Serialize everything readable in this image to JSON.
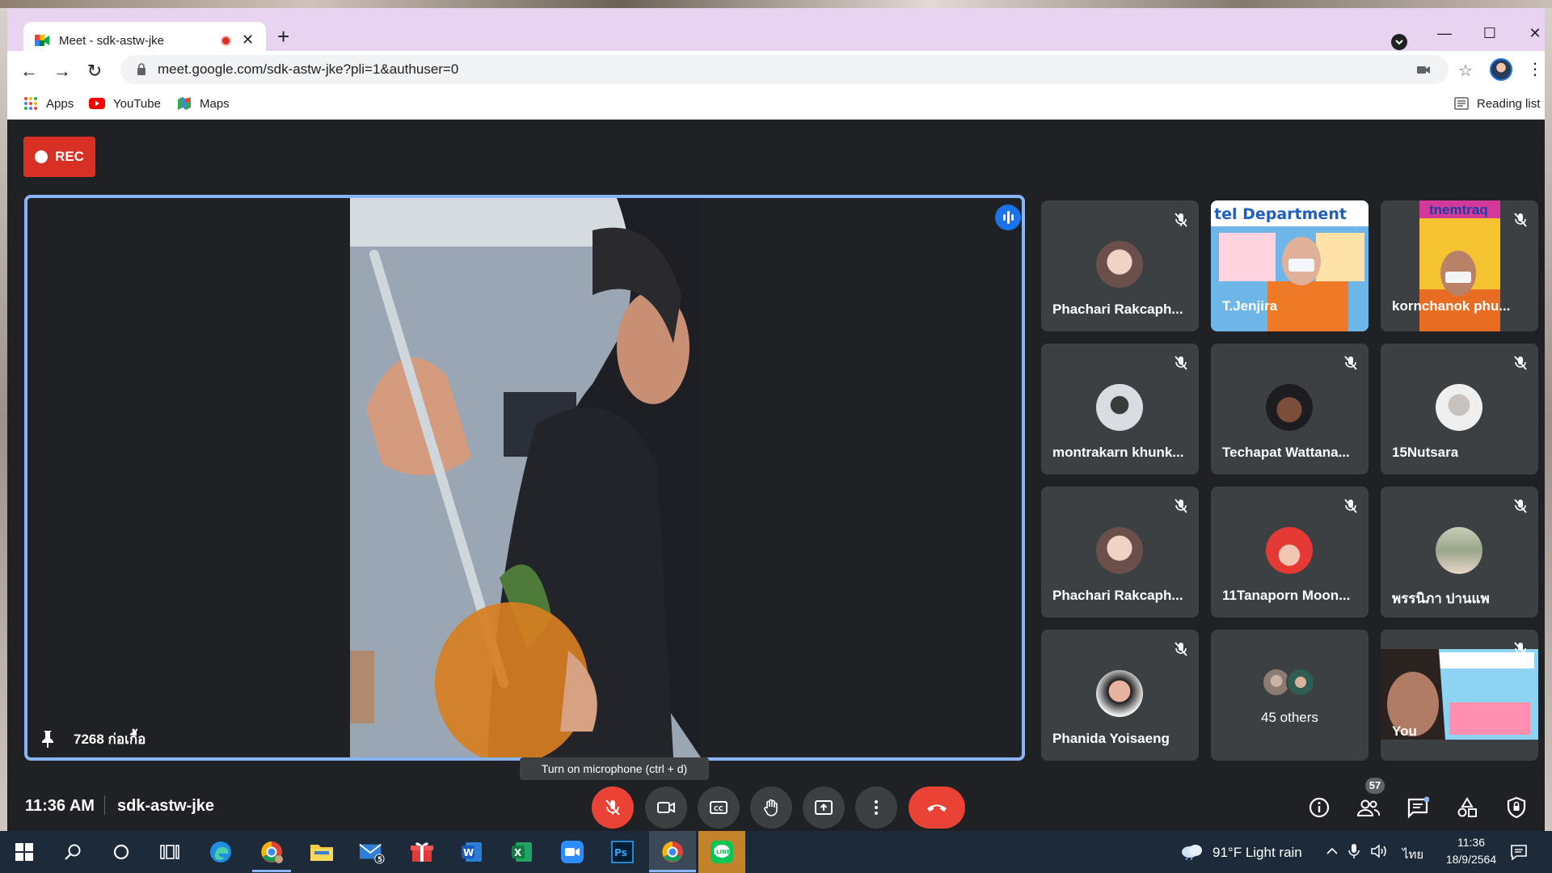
{
  "browser": {
    "tab_title": "Meet - sdk-astw-jke",
    "new_tab": "+",
    "tab_close": "✕",
    "url": "meet.google.com/sdk-astw-jke?pli=1&authuser=0",
    "window": {
      "minimize": "—",
      "maximize": "☐",
      "close": "✕"
    },
    "bookmarks": [
      {
        "label": "Apps",
        "icon": "apps-grid-icon"
      },
      {
        "label": "YouTube",
        "icon": "youtube-icon"
      },
      {
        "label": "Maps",
        "icon": "maps-icon"
      }
    ],
    "reading_list": "Reading list"
  },
  "meet": {
    "rec_label": "REC",
    "main_tile": {
      "name": "7268 ก่อเกื้อ"
    },
    "participants": [
      {
        "name": "Phachari Rakcaph...",
        "type": "avatar",
        "muted": true
      },
      {
        "name": "T.Jenjira",
        "type": "video",
        "muted": true,
        "banner": "tel Department"
      },
      {
        "name": "kornchanok phu...",
        "type": "video",
        "muted": true,
        "banner": "tnemtraq"
      },
      {
        "name": "montrakarn khunk...",
        "type": "avatar",
        "muted": true
      },
      {
        "name": "Techapat Wattana...",
        "type": "avatar",
        "muted": true
      },
      {
        "name": "15Nutsara",
        "type": "avatar",
        "muted": true
      },
      {
        "name": "Phachari Rakcaph...",
        "type": "avatar",
        "muted": true
      },
      {
        "name": "11Tanaporn Moon...",
        "type": "avatar",
        "muted": true
      },
      {
        "name": "พรรนิภา ปานแพ",
        "type": "avatar",
        "muted": true
      },
      {
        "name": "Phanida Yoisaeng",
        "type": "avatar",
        "muted": true
      },
      {
        "name": "45 others",
        "type": "others"
      },
      {
        "name": "You",
        "type": "video",
        "muted": true
      }
    ],
    "tooltip": "Turn on microphone (ctrl + d)",
    "time": "11:36 AM",
    "meeting_code": "sdk-astw-jke",
    "people_count": "57"
  },
  "taskbar": {
    "weather": "91°F  Light rain",
    "language": "ไทย",
    "time": "11:36",
    "date": "18/9/2564",
    "mail_badge": "5"
  },
  "colors": {
    "accent": "#1a73e8",
    "danger": "#ea4335",
    "rec": "#d93025",
    "tile": "#3c4043",
    "meet_bg": "#202124"
  }
}
